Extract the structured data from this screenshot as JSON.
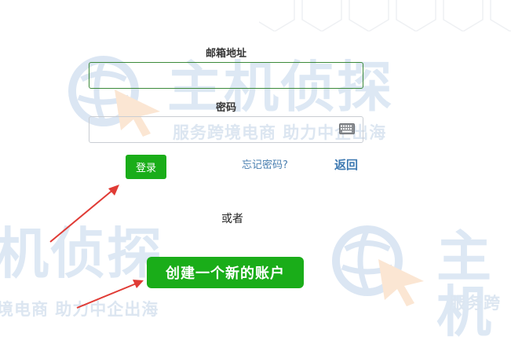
{
  "form": {
    "email_label": "邮箱地址",
    "email_value": "",
    "password_label": "密码",
    "password_value": "",
    "login_button": "登录",
    "forgot_password": "忘记密码?",
    "back_link": "返回",
    "or_text": "或者",
    "create_account_button": "创建一个新的账户"
  },
  "watermark": {
    "brand": "主机侦探",
    "brand_partial_left": "机侦探",
    "brand_partial_right": "主机",
    "slogan": "服务跨境电商 助力中企出海",
    "slogan_partial_left": "境电商 助力中企出海",
    "slogan_partial_right": "服务跨"
  },
  "colors": {
    "accent_green": "#1aad19",
    "link_blue": "#4a7fb0",
    "arrow_red": "#e03b35",
    "watermark": "#dde8f4"
  },
  "icons": {
    "keyboard": "keyboard-icon",
    "arrows": "annotation-arrow"
  }
}
